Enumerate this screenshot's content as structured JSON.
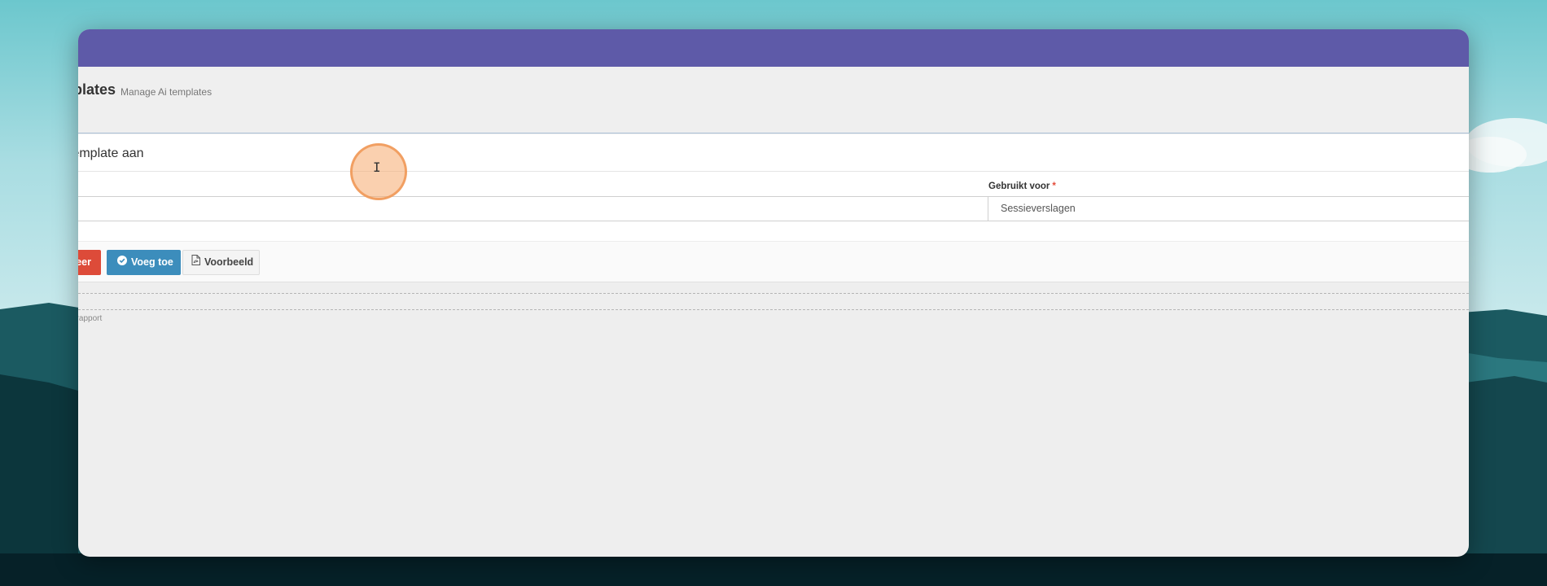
{
  "page": {
    "title": "plates",
    "subtitle": "Manage Ai templates"
  },
  "panel": {
    "heading": "template aan",
    "used_for_label": "Gebruikt voor",
    "required_marker": "*",
    "used_for_value": "Sessieverslagen"
  },
  "actions": {
    "danger_label": "leer",
    "add_label": "Voeg toe",
    "preview_label": "Voorbeeld"
  },
  "footer": {
    "label": "erapport"
  },
  "colors": {
    "topbar": "#5e5aa8",
    "primary": "#3c8dbc",
    "danger": "#dd4b39"
  }
}
